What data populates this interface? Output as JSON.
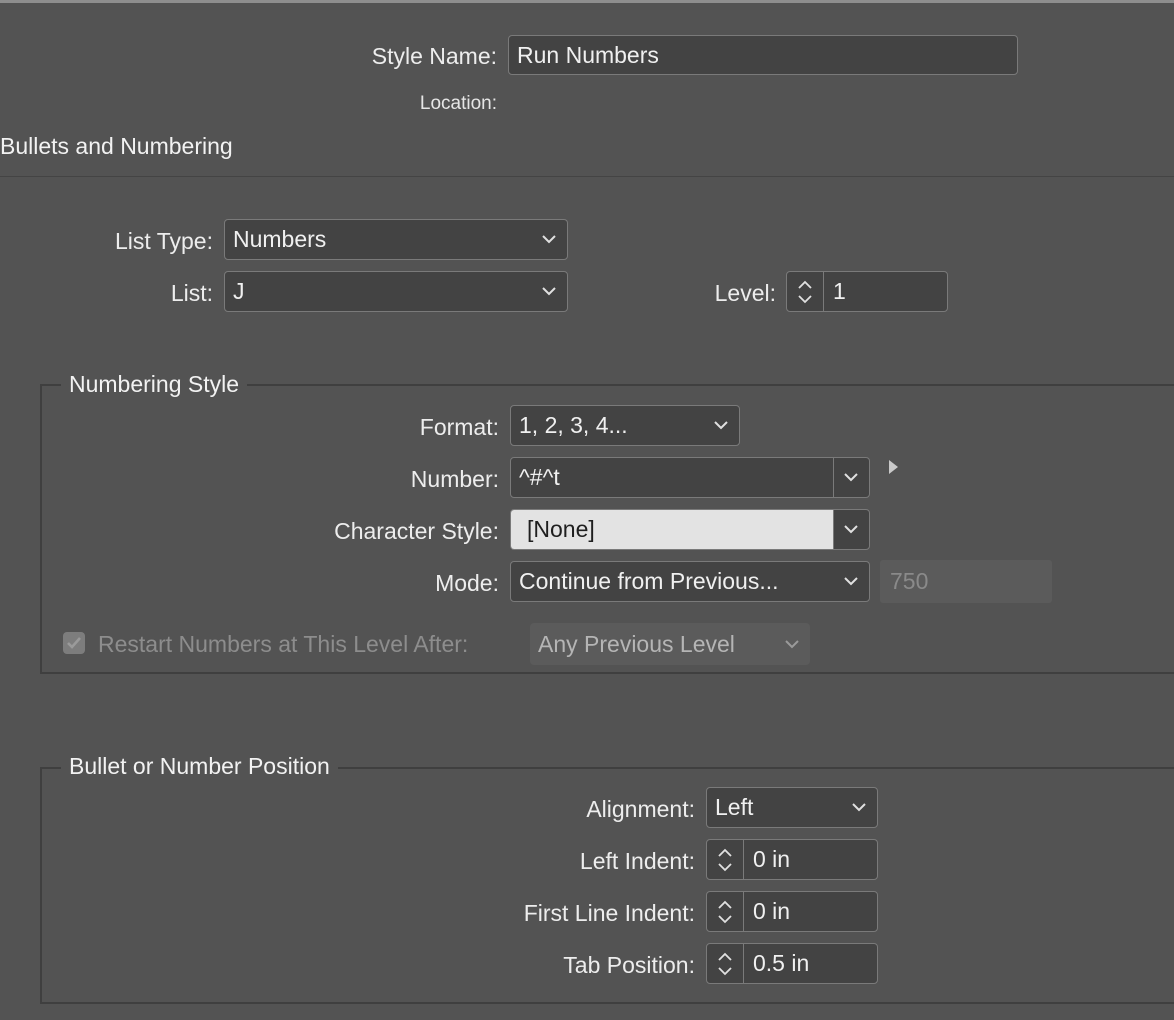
{
  "style_name": {
    "label": "Style Name:",
    "value": "Run Numbers"
  },
  "location": {
    "label": "Location:"
  },
  "section_title": "Bullets and Numbering",
  "list_type": {
    "label": "List Type:",
    "value": "Numbers"
  },
  "list": {
    "label": "List:",
    "value": "J"
  },
  "level": {
    "label": "Level:",
    "value": "1"
  },
  "numbering_style": {
    "title": "Numbering Style",
    "format": {
      "label": "Format:",
      "value": "1, 2, 3, 4..."
    },
    "number": {
      "label": "Number:",
      "value": "^#^t"
    },
    "character_style": {
      "label": "Character Style:",
      "value": "[None]"
    },
    "mode": {
      "label": "Mode:",
      "value": "Continue from Previous...",
      "start_at": "750"
    },
    "restart": {
      "label": "Restart Numbers at This Level After:",
      "checked": true,
      "enabled": false,
      "value": "Any Previous Level"
    }
  },
  "position": {
    "title": "Bullet or Number Position",
    "alignment": {
      "label": "Alignment:",
      "value": "Left"
    },
    "left_indent": {
      "label": "Left Indent:",
      "value": "0 in"
    },
    "first_line_indent": {
      "label": "First Line Indent:",
      "value": "0 in"
    },
    "tab_position": {
      "label": "Tab Position:",
      "value": "0.5 in"
    }
  },
  "icons": {
    "dropdown": "chevron-down-icon",
    "stepper": "stepper-arrows-icon",
    "flyout": "triangle-right-icon",
    "check": "checkmark-icon"
  },
  "colors": {
    "background": "#535353",
    "field": "#434343",
    "highlight_field": "#e3e3e3",
    "border": "#7a7a7a",
    "text": "#ededed",
    "disabled_text": "#8d8d8d"
  }
}
